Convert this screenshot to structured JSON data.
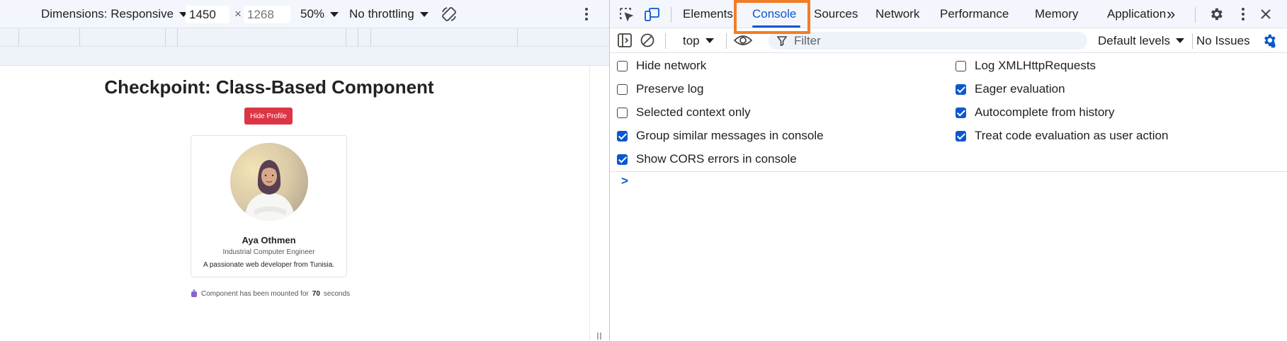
{
  "device_toolbar": {
    "dimensions_label": "Dimensions: Responsive",
    "width_value": "1450",
    "times_sign": "×",
    "height_placeholder": "1268",
    "zoom": "50%",
    "throttling": "No throttling"
  },
  "page": {
    "title": "Checkpoint: Class-Based Component",
    "hide_button": "Hide Profile",
    "profile": {
      "name": "Aya Othmen",
      "role": "Industrial Computer Engineer",
      "bio": "A passionate web developer from Tunisia."
    },
    "mounted_prefix": "Component has been mounted for",
    "mounted_seconds": "70",
    "mounted_suffix": "seconds"
  },
  "devtools": {
    "tabs": [
      "Elements",
      "Console",
      "Sources",
      "Network",
      "Performance",
      "Memory",
      "Application"
    ],
    "active_tab": "Console",
    "more_tabs": "»",
    "context": "top",
    "filter_placeholder": "Filter",
    "levels": "Default levels",
    "issues": "No Issues",
    "settings_left": [
      {
        "label": "Hide network",
        "checked": false
      },
      {
        "label": "Preserve log",
        "checked": false
      },
      {
        "label": "Selected context only",
        "checked": false
      },
      {
        "label": "Group similar messages in console",
        "checked": true
      },
      {
        "label": "Show CORS errors in console",
        "checked": true
      }
    ],
    "settings_right": [
      {
        "label": "Log XMLHttpRequests",
        "checked": false
      },
      {
        "label": "Eager evaluation",
        "checked": true
      },
      {
        "label": "Autocomplete from history",
        "checked": true
      },
      {
        "label": "Treat code evaluation as user action",
        "checked": true
      }
    ],
    "prompt": ">"
  },
  "colors": {
    "accent": "#0b57d0",
    "highlight": "#f07d28",
    "danger": "#dc3545"
  }
}
